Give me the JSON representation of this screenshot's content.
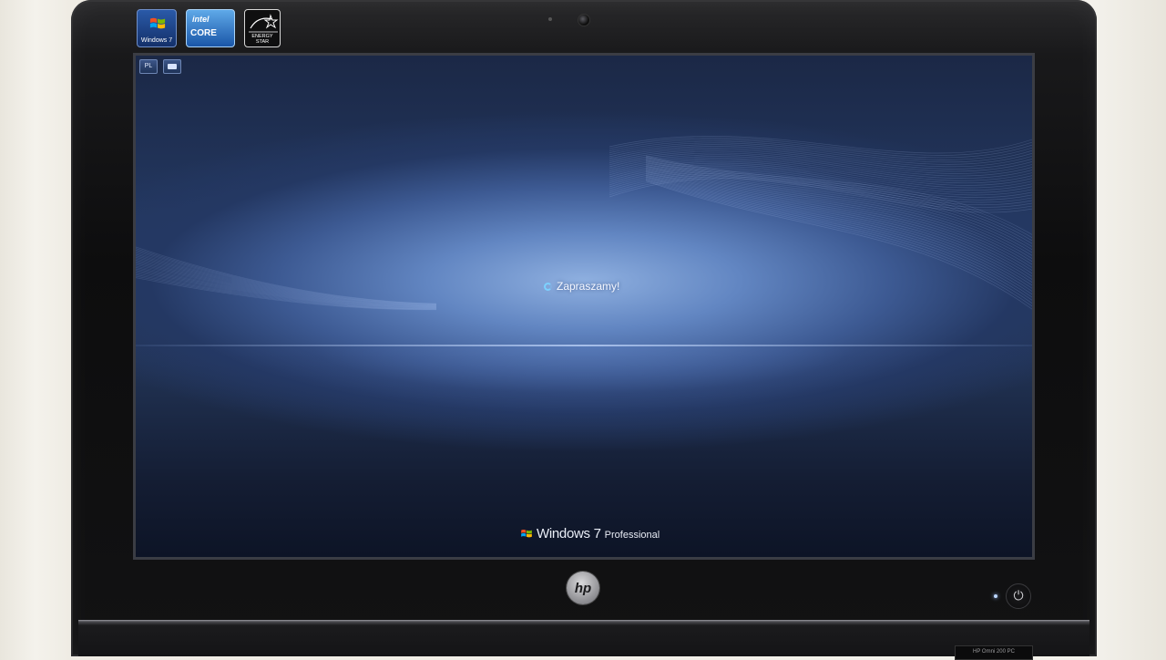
{
  "stickers": {
    "windows": "Windows 7",
    "intel_brand": "intel",
    "intel_line": "CORE",
    "energy": "ENERGY STAR"
  },
  "lang_bar": {
    "language": "PL"
  },
  "screen": {
    "welcome_text": "Zapraszamy!",
    "brand_name": "Windows 7",
    "brand_edition": "Professional"
  },
  "hardware": {
    "logo": "hp",
    "power_symbol": "⏻",
    "model_label": "HP Omni 200 PC"
  },
  "colors": {
    "bezel": "#121213",
    "screen_top": "#1b2846",
    "screen_glow": "#8fb0e0",
    "spinner": "#7cd1ff"
  },
  "icons": [
    "windows-flag-icon",
    "loading-spinner-icon",
    "keyboard-icon",
    "power-icon",
    "camera-icon"
  ]
}
